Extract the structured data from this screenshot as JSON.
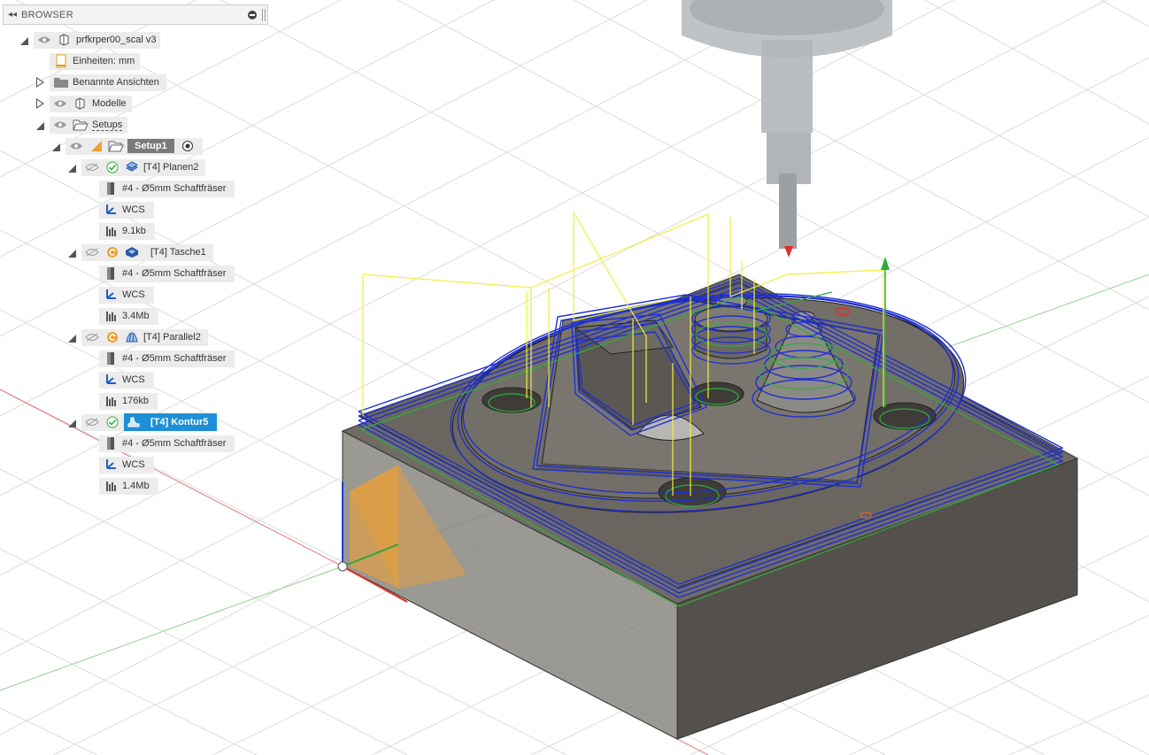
{
  "browser": {
    "title": "BROWSER",
    "collapse_icon": "double-left-arrow",
    "root": {
      "label": "prfkrper00_scal v3"
    },
    "items": [
      {
        "label": "Einheiten: mm"
      },
      {
        "label": "Benannte Ansichten"
      },
      {
        "label": "Modelle"
      },
      {
        "label": "Setups"
      }
    ],
    "setup": {
      "label": "Setup1"
    },
    "operations": [
      {
        "label": "[T4] Planen2",
        "status": "ok",
        "tool": "#4 - Ø5mm Schaftfräser",
        "wcs": "WCS",
        "size": "9.1kb"
      },
      {
        "label": "[T4] Tasche1",
        "status": "regenerate",
        "tool": "#4 - Ø5mm Schaftfräser",
        "wcs": "WCS",
        "size": "3.4Mb"
      },
      {
        "label": "[T4] Parallel2",
        "status": "regenerate",
        "tool": "#4 - Ø5mm Schaftfräser",
        "wcs": "WCS",
        "size": "176kb"
      },
      {
        "label": "[T4] Kontur5",
        "status": "ok",
        "selected": true,
        "tool": "#4 - Ø5mm Schaftfräser",
        "wcs": "WCS",
        "size": "1.4Mb"
      }
    ]
  },
  "colors": {
    "stock_top": "#6f6b65",
    "stock_side_left": "#8a8781",
    "stock_side_right": "#54514c",
    "toolpath_blue": "#1f2fd0",
    "toolpath_green": "#2fae3a",
    "rapid_yellow": "#f2ee3a",
    "selection_blue": "#1e8fd6",
    "orange": "#f0a030"
  }
}
